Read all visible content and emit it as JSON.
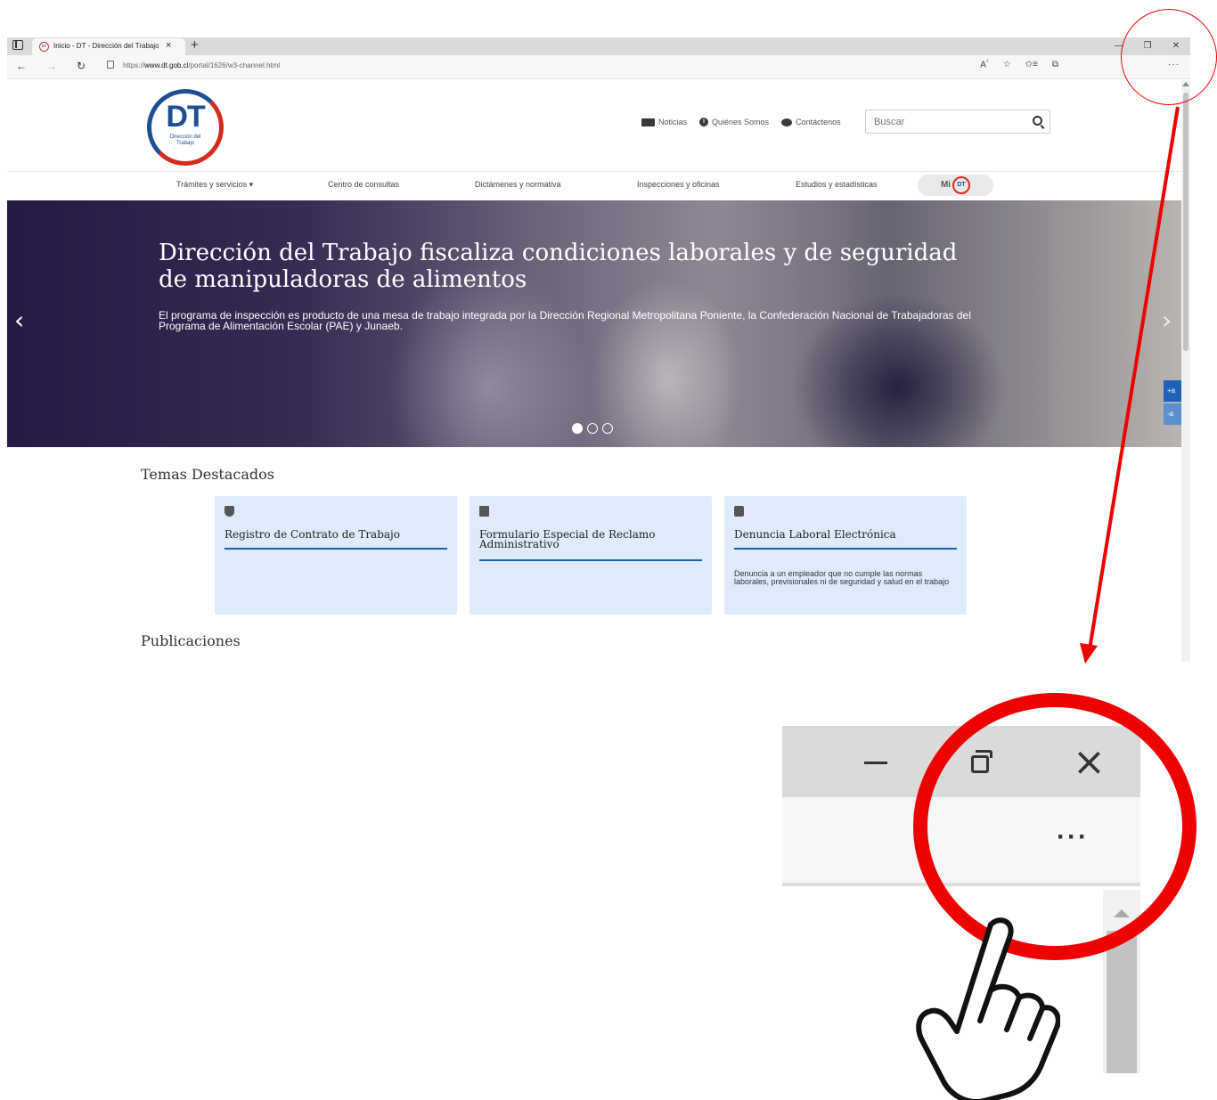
{
  "browser": {
    "tab_title": "Inicio - DT - Dirección del Trabajo",
    "favicon_text": "DT",
    "new_tab": "+",
    "tab_close": "×",
    "window_controls": {
      "minimize": "—",
      "restore": "❐",
      "close": "✕"
    },
    "url_prefix": "https://",
    "url_host": "www.dt.gob.cl",
    "url_path": "/portal/1626/w3-channel.html",
    "more": "···",
    "toolbar_icons": [
      "read-aloud-icon",
      "add-favorite-icon",
      "favorites-icon",
      "collections-icon"
    ]
  },
  "site": {
    "logo": {
      "main": "DT",
      "sub": "Dirección del Trabajo"
    },
    "top_links": [
      "Noticias",
      "Quiénes Somos",
      "Contáctenos"
    ],
    "search_placeholder": "Buscar",
    "nav": [
      "Trámites y servicios ▾",
      "Centro de consultas",
      "Dictámenes y normativa",
      "Inspecciones y oficinas",
      "Estudios y estadísticas"
    ],
    "mi_dt": {
      "label": "Mi",
      "badge": "DT"
    },
    "hero": {
      "title": "Dirección del Trabajo fiscaliza condiciones laborales y de seguridad de manipuladoras de alimentos",
      "description": "El programa de inspección es producto de una mesa de trabajo integrada por la Dirección Regional Metropolitana Poniente, la Confederación Nacional de Trabajadoras del Programa de Alimentación Escolar (PAE) y Junaeb.",
      "prev": "‹",
      "next": "›",
      "side_tabs": [
        "+a",
        "-a"
      ],
      "slide_count": 3,
      "active_slide": 1
    },
    "featured": {
      "title": "Temas Destacados",
      "cards": [
        {
          "icon": "shield-icon",
          "title": "Registro de Contrato de Trabajo",
          "description": ""
        },
        {
          "icon": "clipboard-icon",
          "title": "Formulario Especial de Reclamo Administrativo",
          "description": ""
        },
        {
          "icon": "alert-icon",
          "title": "Denuncia Laboral Electrónica",
          "description": "Denuncia a un empleador que no cumple las normas laborales, previsionales ni de seguridad y salud en el trabajo"
        }
      ]
    },
    "publications_title": "Publicaciones"
  },
  "annotation": {
    "zoom_close": "×",
    "zoom_more": "···",
    "accent": "#e00000"
  }
}
